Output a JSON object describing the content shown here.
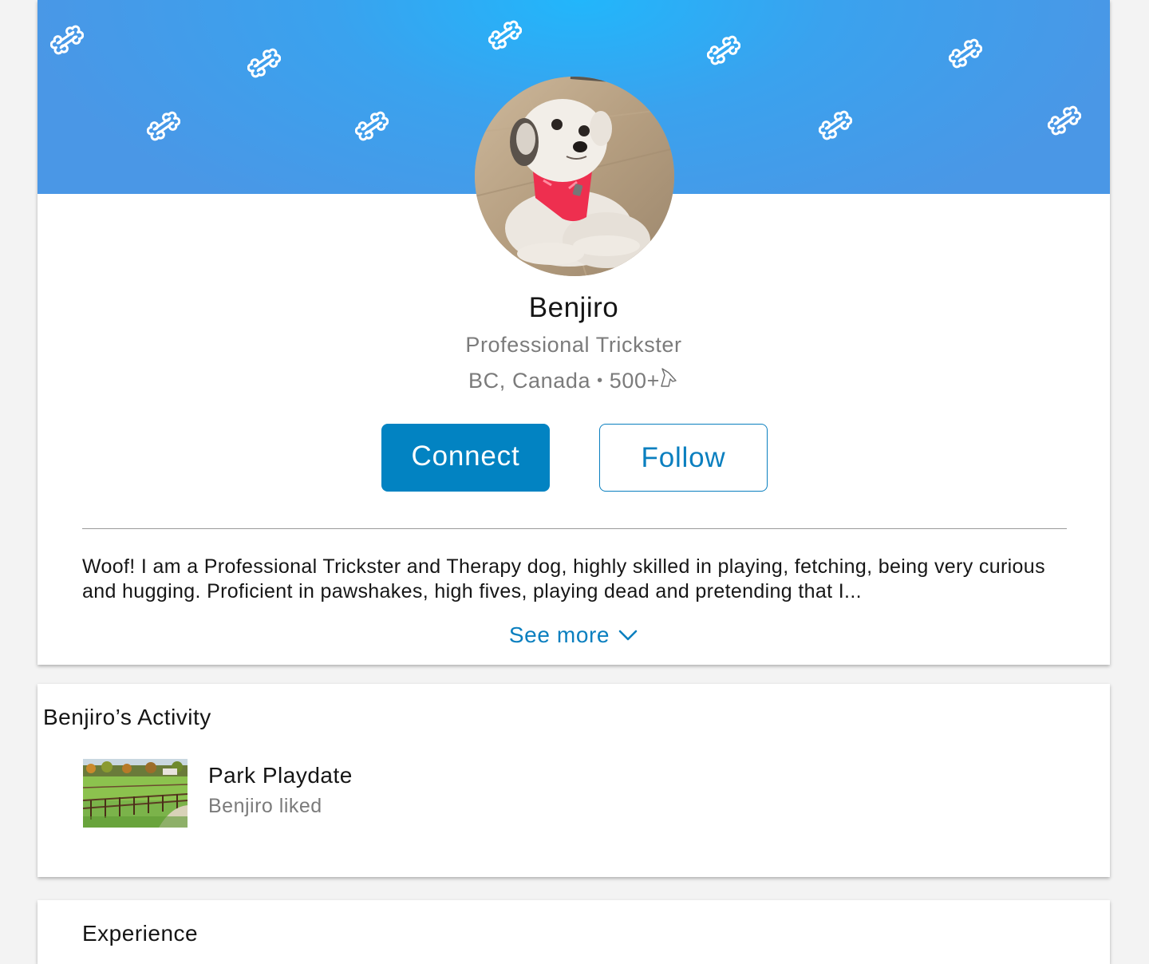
{
  "profile": {
    "name": "Benjiro",
    "headline": "Professional Trickster",
    "location": "BC, Canada",
    "separator": "•",
    "connections": "500+",
    "connections_icon": "dog-head-icon",
    "banner_icon": "bone-icon",
    "avatar_icon": "profile-photo"
  },
  "actions": {
    "connect_label": "Connect",
    "follow_label": "Follow"
  },
  "about": {
    "text": "Woof! I am a Professional Trickster and Therapy dog, highly skilled in playing, fetching, being very curious and hugging. Proficient in pawshakes, high fives, playing dead and pretending that I...",
    "see_more_label": "See more",
    "see_more_icon": "chevron-down-icon"
  },
  "activity": {
    "title": "Benjiro’s Activity",
    "items": [
      {
        "title": "Park Playdate",
        "subtitle": "Benjiro liked",
        "thumbnail": "park-thumbnail"
      }
    ]
  },
  "experience": {
    "title": "Experience"
  },
  "colors": {
    "accent": "#0283c2",
    "banner": "#4a97e6",
    "banner_highlight": "#22b6fb",
    "muted_text": "#7b7b7b",
    "background": "#f3f3f3"
  }
}
